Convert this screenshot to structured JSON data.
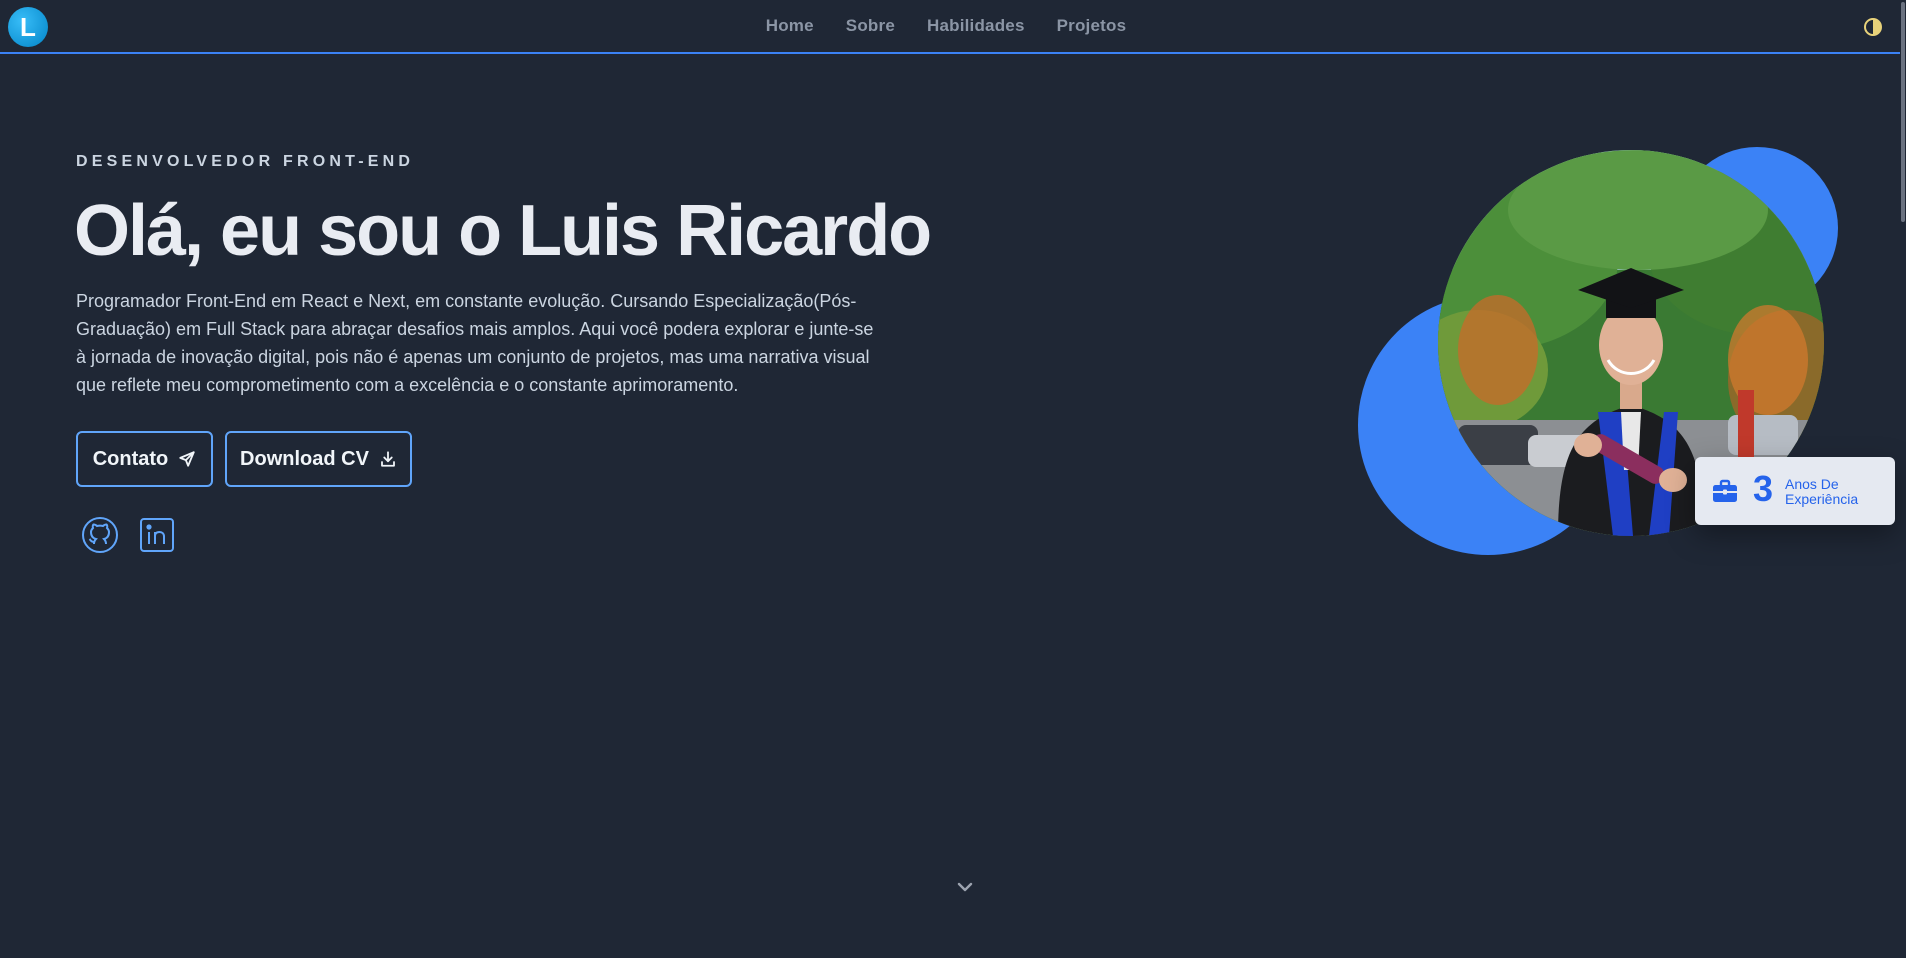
{
  "nav": {
    "logo_letter": "L",
    "links": [
      "Home",
      "Sobre",
      "Habilidades",
      "Projetos"
    ]
  },
  "hero": {
    "eyebrow": "DESENVOLVEDOR FRONT-END",
    "title": "Olá, eu sou o Luis Ricardo",
    "description": "Programador Front-End em React e Next, em constante evolução. Cursando Especialização(Pós-Graduação) em Full Stack para abraçar desafios mais amplos. Aqui você podera explorar e junte-se à jornada de inovação digital, pois não é apenas um conjunto de projetos, mas uma narrativa visual que reflete meu comprometimento com a excelência e o constante aprimoramento.",
    "contact_label": "Contato",
    "cv_label": "Download CV"
  },
  "experience": {
    "number": "3",
    "line1": "Anos De",
    "line2": "Experiência"
  },
  "icons": {
    "contact": "send-icon",
    "cv": "download-icon",
    "github": "github-icon",
    "linkedin": "linkedin-icon",
    "experience": "briefcase-icon",
    "scroll": "chevron-down-icon",
    "theme": "theme-toggle-icon"
  },
  "colors": {
    "background": "#1f2735",
    "accent": "#3b82f6",
    "card": "#e5e9f1"
  }
}
